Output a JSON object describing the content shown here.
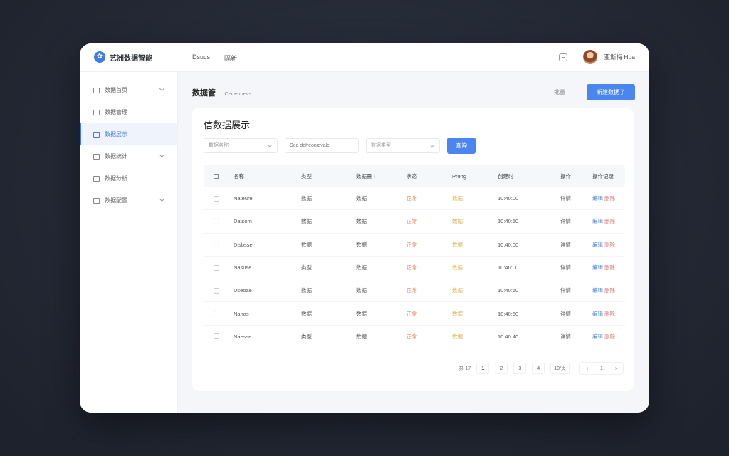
{
  "brand": {
    "name": "艺洲数据智能"
  },
  "topnav": [
    {
      "label": "Dsucs"
    },
    {
      "label": "隔新"
    }
  ],
  "user": {
    "name": "亚斯梅 Hua"
  },
  "sidebar": {
    "items": [
      {
        "label": "数据首页",
        "icon": "dashboard-icon",
        "expandable": true,
        "active": false
      },
      {
        "label": "数据管理",
        "icon": "database-icon",
        "expandable": false,
        "active": false
      },
      {
        "label": "数据展示",
        "icon": "table-icon",
        "expandable": false,
        "active": true
      },
      {
        "label": "数据统计",
        "icon": "chart-icon",
        "expandable": true,
        "active": false
      },
      {
        "label": "数据分析",
        "icon": "analysis-icon",
        "expandable": false,
        "active": false
      },
      {
        "label": "数据配置",
        "icon": "settings-icon",
        "expandable": true,
        "active": false
      }
    ]
  },
  "page": {
    "title": "数据管",
    "breadcrumb": "Ceoenpevs",
    "secondary_action": "批量",
    "primary_action": "新建数据了"
  },
  "card": {
    "title": "信数据展示"
  },
  "filters": {
    "field1_placeholder": "数据名称",
    "field2_placeholder": "Sea daheoniovalc",
    "field3_placeholder": "数据类型",
    "search_label": "查询"
  },
  "table": {
    "headers": [
      "名称",
      "类型",
      "数据量",
      "状态",
      "Preng",
      "创建时",
      "操作",
      "操作记录"
    ],
    "rows": [
      {
        "name": "Nateure",
        "type": "数据",
        "count": "数据",
        "status": "正常",
        "tag": "数据",
        "time": "10:40:00",
        "op": "详情",
        "act1": "编辑",
        "act2": "删除"
      },
      {
        "name": "Datsom",
        "type": "数据",
        "count": "数据",
        "status": "正常",
        "tag": "数据",
        "time": "10:40:50",
        "op": "详情",
        "act1": "编辑",
        "act2": "删除"
      },
      {
        "name": "Disbsse",
        "type": "数据",
        "count": "数据",
        "status": "正常",
        "tag": "数据",
        "time": "10:40:00",
        "op": "详情",
        "act1": "编辑",
        "act2": "删除"
      },
      {
        "name": "Nasuse",
        "type": "类型",
        "count": "数据",
        "status": "正常",
        "tag": "数据",
        "time": "10:40:00",
        "op": "详情",
        "act1": "编辑",
        "act2": "删除"
      },
      {
        "name": "Dseoae",
        "type": "数据",
        "count": "数据",
        "status": "正常",
        "tag": "数据",
        "time": "10:40:50",
        "op": "详情",
        "act1": "编辑",
        "act2": "删除"
      },
      {
        "name": "Nanas",
        "type": "数据",
        "count": "数据",
        "status": "正常",
        "tag": "数据",
        "time": "10:40:50",
        "op": "详情",
        "act1": "编辑",
        "act2": "删除"
      },
      {
        "name": "Naesse",
        "type": "类型",
        "count": "数据",
        "status": "正常",
        "tag": "数据",
        "time": "10:40:40",
        "op": "详情",
        "act1": "编辑",
        "act2": "删除"
      }
    ]
  },
  "pagination": {
    "total_label": "共 17",
    "pages": [
      "1",
      "2",
      "3",
      "4"
    ],
    "size_label": "10/页",
    "nav": [
      "‹",
      "1",
      "›"
    ]
  },
  "colors": {
    "accent": "#4a86ee",
    "status_orange": "#e8865a",
    "tag_yellow": "#d9b24c",
    "danger": "#e67d7d"
  }
}
